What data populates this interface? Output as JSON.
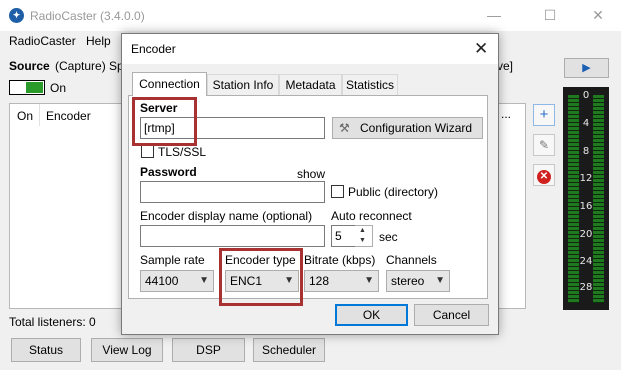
{
  "main_window": {
    "title": "RadioCaster (3.4.0.0)",
    "menu": [
      "RadioCaster",
      "Help"
    ],
    "source_label": "Source",
    "source_detail": "(Capture) Sp",
    "source_tail": "ve]",
    "toggle_label": "On",
    "list_columns": [
      "On",
      "Encoder"
    ],
    "list_more": "...",
    "total_listeners": "Total listeners: 0",
    "buttons": [
      "Status",
      "View Log",
      "DSP",
      "Scheduler"
    ],
    "play_icon": "play-icon",
    "vu_labels": [
      "0",
      "4",
      "8",
      "12",
      "16",
      "20",
      "24",
      "28"
    ],
    "vu_color": "#1f7a1f"
  },
  "dialog": {
    "title": "Encoder",
    "tabs": [
      "Connection",
      "Station Info",
      "Metadata",
      "Statistics"
    ],
    "active_tab": "Connection",
    "server_label": "Server",
    "server_value": "[rtmp]",
    "config_wizard": "Configuration Wizard",
    "tls_label": "TLS/SSL",
    "password_label": "Password",
    "show_label": "show",
    "password_value": "",
    "public_label": "Public (directory)",
    "display_name_label": "Encoder display name (optional)",
    "display_name_value": "",
    "auto_reconnect_label": "Auto reconnect",
    "auto_reconnect_value": "5",
    "auto_reconnect_unit": "sec",
    "sample_rate_label": "Sample rate",
    "sample_rate_value": "44100",
    "encoder_type_label": "Encoder type",
    "encoder_type_value": "ENC1",
    "bitrate_label": "Bitrate (kbps)",
    "bitrate_value": "128",
    "channels_label": "Channels",
    "channels_value": "stereo",
    "ok": "OK",
    "cancel": "Cancel"
  },
  "highlight_color": "#a83232"
}
